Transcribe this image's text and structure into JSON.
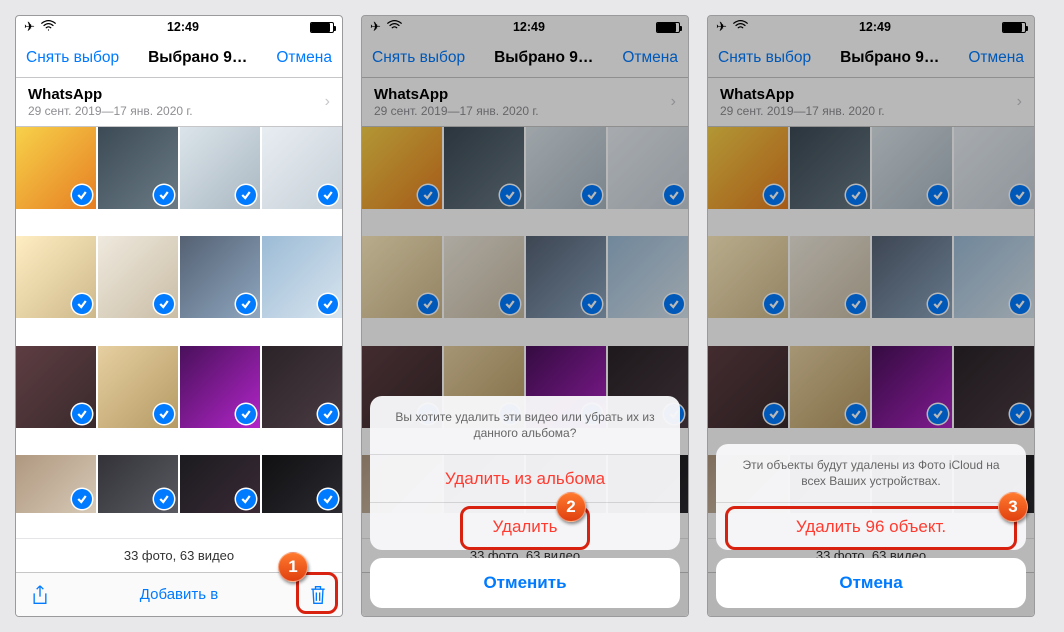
{
  "status": {
    "time": "12:49"
  },
  "nav": {
    "deselect": "Снять выбор",
    "title": "Выбрано 9…",
    "cancel": "Отмена"
  },
  "album": {
    "title": "WhatsApp",
    "range": "29 сент. 2019—17 янв. 2020 г."
  },
  "counts": "33 фото, 63 видео",
  "toolbar": {
    "add_to": "Добавить в"
  },
  "sheet1": {
    "message": "Вы хотите удалить эти видео или убрать их из данного альбома?",
    "remove_from_album": "Удалить из альбома",
    "delete": "Удалить",
    "cancel": "Отменить"
  },
  "sheet2": {
    "message": "Эти объекты будут удалены из Фото iCloud на всех Ваших устройствах.",
    "delete_count": "Удалить 96 объект.",
    "cancel": "Отмена"
  },
  "steps": {
    "one": "1",
    "two": "2",
    "three": "3"
  }
}
